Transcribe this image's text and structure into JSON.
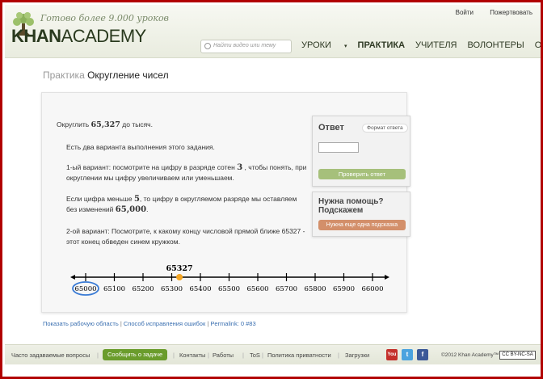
{
  "header": {
    "tagline": "Готово более 9.000 уроков",
    "logo_khan": "KHAN",
    "logo_academy": "ACADEMY",
    "login": "Войти",
    "donate": "Пожертвовать",
    "search_placeholder": "Найти видео или тему",
    "nav": {
      "lessons": "УРОКИ",
      "practice": "ПРАКТИКА",
      "teachers": "УЧИТЕЛЯ",
      "volunteers": "ВОЛОНТЕРЫ",
      "about": "О ПРОЕКТЕ"
    }
  },
  "breadcrumb": {
    "parent": "Практика",
    "title": "Округление чисел"
  },
  "exercise": {
    "question_pre": "Округлить",
    "question_num": "65,327",
    "question_post": "до тысяч.",
    "hint1": "Есть два варианта выполнения этого задания.",
    "hint2_a": "1-ый вариант: посмотрите на цифру в разряде сотен",
    "hint2_num": "3",
    "hint2_b": ", чтобы понять, при округлении мы цифру увеличиваем или уменьшаем.",
    "hint3_a": "Если цифра меньше",
    "hint3_num": "5",
    "hint3_b": ", то цифру в округляемом разряде мы оставляем без изменений",
    "hint3_result": "65,000",
    "hint4": "2-ой вариант: Посмотрите, к какому концу числовой прямой ближе 65327 - этот конец обведен синем кружком.",
    "marker_label": "65327",
    "ticks": [
      "65000",
      "65100",
      "65200",
      "65300",
      "65400",
      "65500",
      "65600",
      "65700",
      "65800",
      "65900",
      "66000"
    ],
    "marker_value": 65327,
    "circled_tick": "65000",
    "colors": {
      "marker": "#f5a623",
      "circle": "#3a7bd5"
    }
  },
  "answer": {
    "title": "Ответ",
    "format_label": "Формат ответа",
    "value": "",
    "check_label": "Проверить ответ"
  },
  "help": {
    "title": "Нужна помощь? Подскажем",
    "hint_button": "Нужна еще одна подсказка"
  },
  "below_links": {
    "workarea": "Показать рабочую область",
    "bugfix": "Способ исправления ошибок",
    "permalink": "Permalink: 0 #83",
    "sep": "|"
  },
  "footer": {
    "faq": "Часто задаваемые вопросы",
    "report": "Сообщить о задаче",
    "contacts": "Контакты",
    "jobs": "Работы",
    "tos": "ToS",
    "privacy": "Политика приватности",
    "downloads": "Загрузки",
    "youtube": "You",
    "twitter": "t",
    "facebook": "f",
    "copyright": "©2012 Khan Academy™",
    "license": "CC BY-NC-SA"
  }
}
